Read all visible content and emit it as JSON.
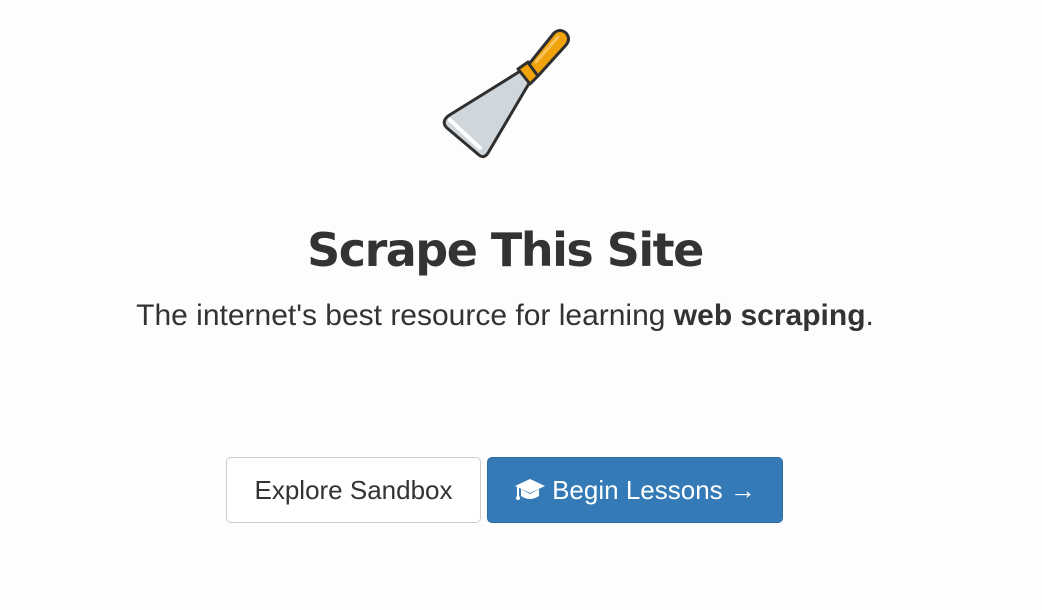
{
  "hero": {
    "logo_icon": "putty-knife-icon",
    "title": "Scrape This Site",
    "tagline_prefix": "The internet's best resource for learning ",
    "tagline_emphasis": "web scraping",
    "tagline_suffix": "."
  },
  "buttons": {
    "explore_label": "Explore Sandbox",
    "lessons_icon": "graduation-cap-icon",
    "lessons_label": "Begin Lessons →"
  },
  "colors": {
    "primary": "#337ab7",
    "text": "#333333",
    "knife_handle": "#f0a30a",
    "knife_blade": "#cfd6dc"
  }
}
